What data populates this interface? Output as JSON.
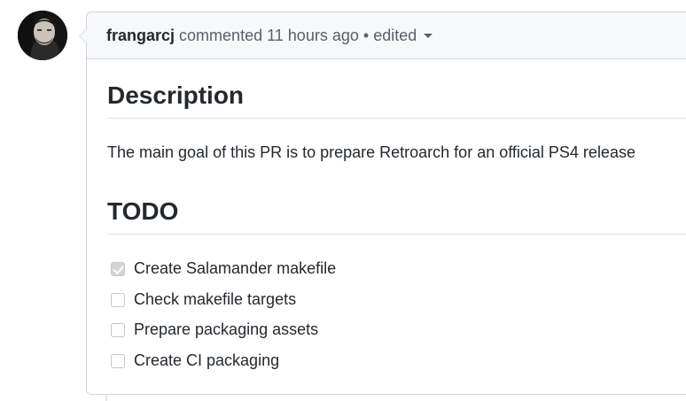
{
  "comment": {
    "author": "frangarcj",
    "action": "commented",
    "time": "11 hours ago",
    "separator": "•",
    "edited_label": "edited",
    "body": {
      "heading_description": "Description",
      "paragraph": "The main goal of this PR is to prepare Retroarch for an official PS4 release",
      "heading_todo": "TODO",
      "tasks": [
        {
          "label": "Create Salamander makefile",
          "checked": true
        },
        {
          "label": "Check makefile targets",
          "checked": false
        },
        {
          "label": "Prepare packaging assets",
          "checked": false
        },
        {
          "label": "Create CI packaging",
          "checked": false
        }
      ]
    }
  },
  "icons": {
    "avatar": "user-avatar",
    "edited_dropdown": "caret-down-icon",
    "task_checkbox_checked": "checkbox-checked-icon",
    "task_checkbox_unchecked": "checkbox-unchecked-icon"
  },
  "colors": {
    "header_bg": "#f6f8fa",
    "border": "#d1d5da",
    "text": "#24292e",
    "muted_text": "#586069",
    "checked_box": "#d5d5d5"
  }
}
